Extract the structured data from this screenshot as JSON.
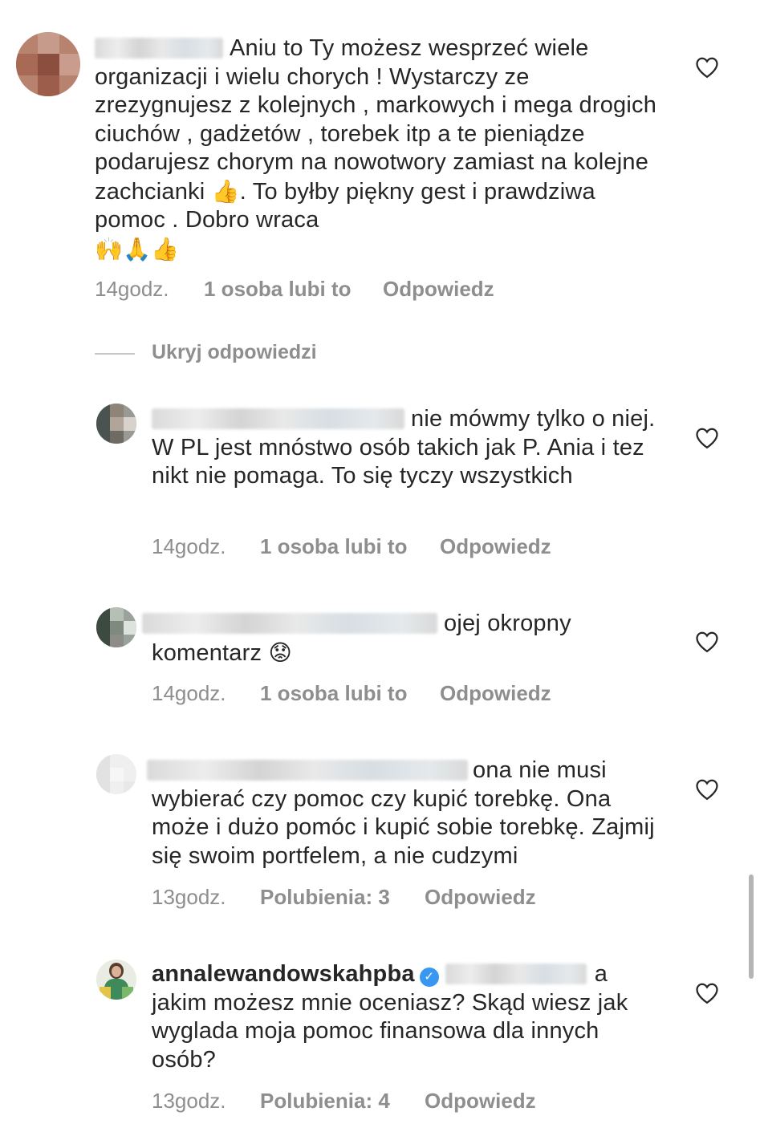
{
  "comments": [
    {
      "text": "Aniu to Ty możesz wesprzeć wiele organizacji i wielu chorych ! Wystarczy ze zrezygnujesz z kolejnych , markowych i mega drogich ciuchów , gadżetów , torebek itp a te pieniądze podarujesz chorym na nowotwory zamiast na kolejne zachcianki",
      "emoji_1": "👍",
      "text_2": ". To byłby piękny gest i prawdziwa pomoc . Dobro wraca",
      "emoji_2": "🙌🙏👍",
      "time": "14godz.",
      "likes": "1 osoba lubi to",
      "reply": "Odpowiedz"
    },
    {
      "text": "nie mówmy tylko o niej. W PL jest mnóstwo osób takich jak P. Ania i tez nikt nie pomaga. To się tyczy wszystkich",
      "time": "14godz.",
      "likes": "1 osoba lubi to",
      "reply": "Odpowiedz"
    },
    {
      "text": "ojej okropny komentarz",
      "emoji_1": "😟",
      "time": "14godz.",
      "likes": "1 osoba lubi to",
      "reply": "Odpowiedz"
    },
    {
      "text": "ona nie musi wybierać czy pomoc czy kupić torebkę. Ona może i dużo pomóc i kupić sobie torebkę. Zajmij się swoim portfelem, a nie cudzymi",
      "time": "13godz.",
      "likes": "Polubienia: 3",
      "reply": "Odpowiedz"
    },
    {
      "username": "annalewandowskahpba",
      "verified_mark": "✓",
      "text": "a jakim możesz mnie oceniasz? Skąd wiesz jak wyglada moja pomoc finansowa dla innych osób?",
      "time": "13godz.",
      "likes": "Polubienia: 4",
      "reply": "Odpowiedz"
    }
  ],
  "replies_toggle": "Ukryj odpowiedzi",
  "icons": {
    "like": "heart-outline-icon",
    "verified": "verified-badge-icon"
  },
  "colors": {
    "text": "#262626",
    "meta": "#8e8e8e",
    "verified": "#3897f0"
  }
}
